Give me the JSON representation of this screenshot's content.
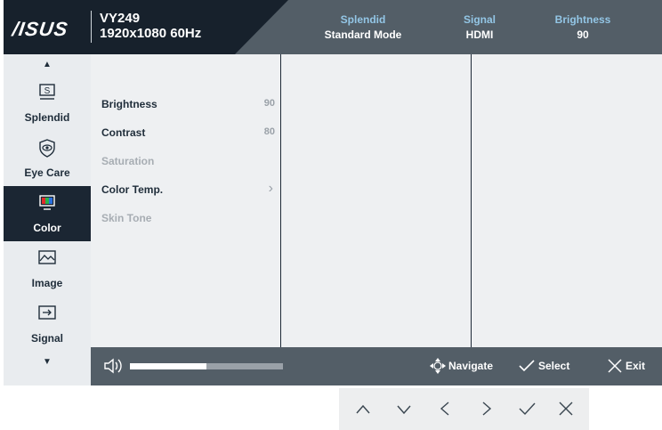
{
  "header": {
    "brand": "/ISUS",
    "model": "VY249",
    "resolution": "1920x1080 60Hz",
    "status": [
      {
        "label": "Splendid",
        "value": "Standard Mode"
      },
      {
        "label": "Signal",
        "value": "HDMI"
      },
      {
        "label": "Brightness",
        "value": "90"
      }
    ]
  },
  "sidebar": {
    "items": [
      {
        "label": "Splendid",
        "icon": "splendid-icon"
      },
      {
        "label": "Eye Care",
        "icon": "eye-care-icon"
      },
      {
        "label": "Color",
        "icon": "color-icon",
        "active": true
      },
      {
        "label": "Image",
        "icon": "image-icon"
      },
      {
        "label": "Signal",
        "icon": "signal-icon"
      }
    ]
  },
  "menu": {
    "rows": [
      {
        "label": "Brightness",
        "value": "90",
        "enabled": true
      },
      {
        "label": "Contrast",
        "value": "80",
        "enabled": true
      },
      {
        "label": "Saturation",
        "value": "",
        "enabled": false
      },
      {
        "label": "Color Temp.",
        "value": "",
        "submenu": true,
        "enabled": true
      },
      {
        "label": "Skin Tone",
        "value": "",
        "enabled": false
      }
    ]
  },
  "footer": {
    "volume_level": 0.5,
    "navigate_label": "Navigate",
    "select_label": "Select",
    "exit_label": "Exit"
  },
  "colors": {
    "header_dark": "#17212c",
    "header_grey": "#535e67",
    "accent_text": "#93c6e6",
    "active_item": "#1b2633"
  }
}
